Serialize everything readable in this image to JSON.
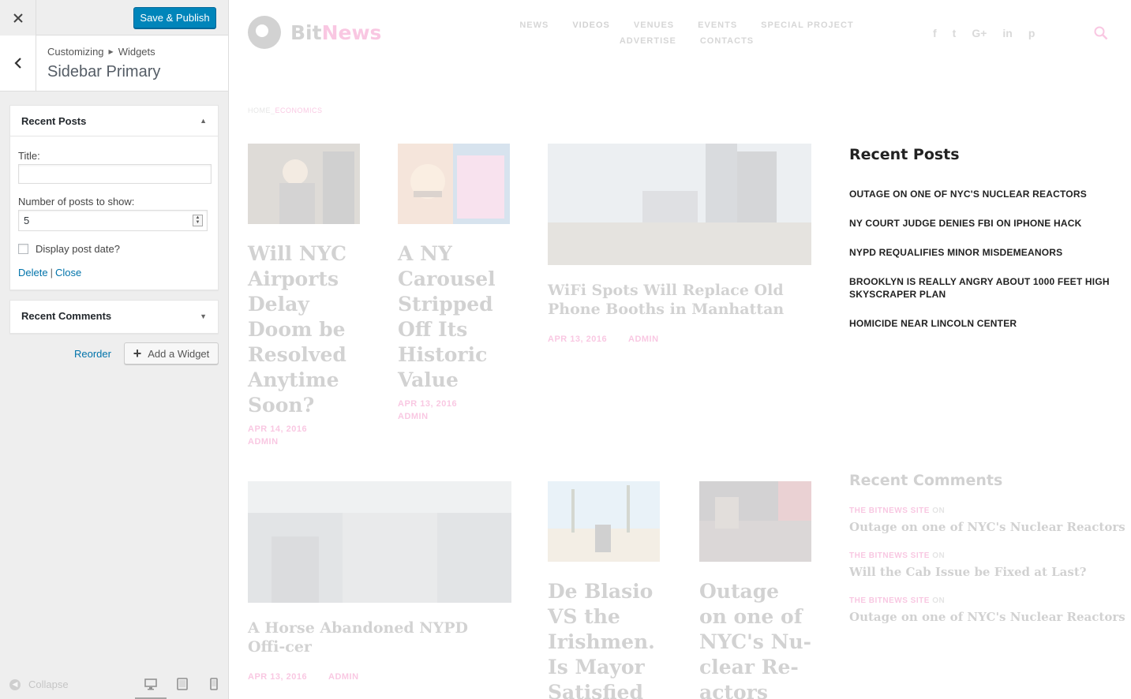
{
  "customizer": {
    "close_icon": "close-icon",
    "publish_label": "Save & Publish",
    "breadcrumb": [
      "Customizing",
      "Widgets"
    ],
    "section_title": "Sidebar Primary",
    "widgets": {
      "recent_posts": {
        "title": "Recent Posts",
        "title_label": "Title:",
        "title_value": "",
        "number_label": "Number of posts to show:",
        "number_value": "5",
        "date_label": "Display post date?",
        "delete_label": "Delete",
        "separator": "|",
        "close_label": "Close"
      },
      "recent_comments": {
        "title": "Recent Comments"
      }
    },
    "reorder_label": "Reorder",
    "add_widget_label": "Add a Widget",
    "collapse_label": "Collapse",
    "colors": {
      "primary": "#0085ba",
      "link": "#0073aa"
    }
  },
  "site": {
    "logo": {
      "part1": "Bit",
      "part2": "News"
    },
    "nav_row1": [
      "NEWS",
      "VIDEOS",
      "VENUES",
      "EVENTS",
      "SPECIAL PROJECT"
    ],
    "nav_row2": [
      "ADVERTISE",
      "CONTACTS"
    ],
    "social": [
      "f",
      "t",
      "G+",
      "in",
      "p"
    ],
    "breadcrumb": {
      "home": "HOME",
      "sep": "_",
      "current": "ECONOMICS"
    },
    "posts": [
      {
        "title": "Will NYC Airports Delay Doom be Resolved Anytime Soon?",
        "date": "APR 14, 2016",
        "author": "ADMIN"
      },
      {
        "title": "A NY Carousel Stripped Off Its Historic Value",
        "date": "APR 13, 2016",
        "author": "ADMIN"
      },
      {
        "title": "WiFi Spots Will Replace Old Phone Booths in Manhattan",
        "date": "APR 13, 2016",
        "author": "ADMIN"
      },
      {
        "title": "A Horse Abandoned NYPD Offi-cer",
        "date": "APR 13, 2016",
        "author": "ADMIN"
      },
      {
        "title": "De Blasio VS the Irishmen. Is Mayor Satisfied",
        "date": "",
        "author": ""
      },
      {
        "title": "Outage on one of NYC's Nu-clear Re-actors",
        "date": "",
        "author": ""
      }
    ],
    "recent_posts": {
      "heading": "Recent Posts",
      "items": [
        "OUTAGE ON ONE OF NYC'S NUCLEAR REACTORS",
        "NY COURT JUDGE DENIES FBI ON IPHONE HACK",
        "NYPD REQUALIFIES MINOR MISDEMEANORS",
        "BROOKLYN IS REALLY ANGRY ABOUT 1000 FEET HIGH SKYSCRAPER PLAN",
        "HOMICIDE NEAR LINCOLN CENTER"
      ]
    },
    "recent_comments": {
      "heading": "Recent Comments",
      "items": [
        {
          "author": "THE BITNEWS SITE",
          "on": "ON",
          "post": "Outage on one of NYC's Nuclear Reactors"
        },
        {
          "author": "THE BITNEWS SITE",
          "on": "ON",
          "post": "Will the Cab Issue be Fixed at Last?"
        },
        {
          "author": "THE BITNEWS SITE",
          "on": "ON",
          "post": "Outage on one of NYC's Nuclear Reactors"
        }
      ]
    },
    "colors": {
      "accent": "#e4007c"
    }
  }
}
